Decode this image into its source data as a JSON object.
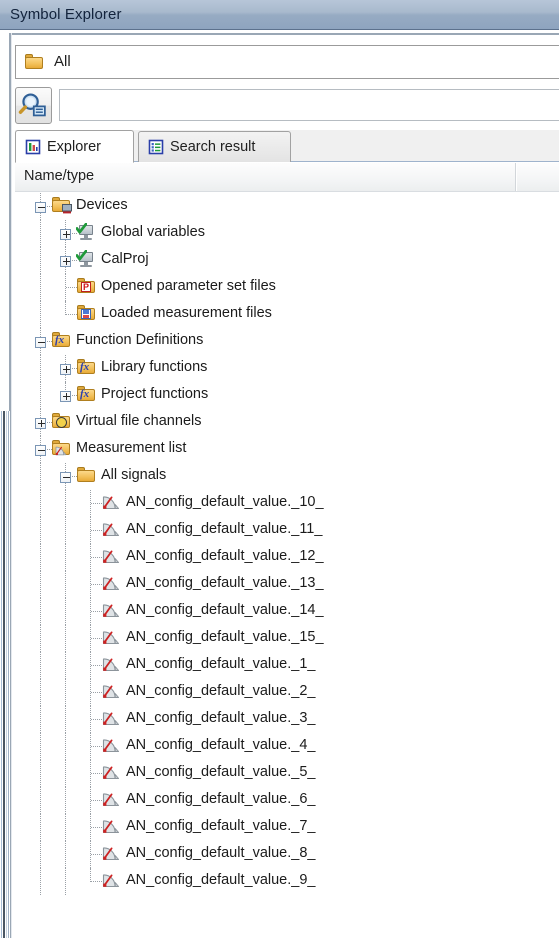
{
  "window": {
    "title": "Symbol Explorer"
  },
  "filter_bar": {
    "icon": "folder-icon",
    "label": "All"
  },
  "search": {
    "button_icon": "search-magnifier-icon",
    "value": "",
    "placeholder": ""
  },
  "tabs": [
    {
      "id": "explorer",
      "label": "Explorer",
      "icon": "explorer-tab-icon",
      "active": true
    },
    {
      "id": "search-result",
      "label": "Search result",
      "icon": "search-result-tab-icon",
      "active": false
    }
  ],
  "columns": [
    {
      "id": "name-type",
      "label": "Name/type"
    }
  ],
  "tree": [
    {
      "id": "devices",
      "label": "Devices",
      "icon": "devices-folder-icon",
      "depth": 0,
      "state": "expanded"
    },
    {
      "id": "global-variables",
      "label": "Global variables",
      "icon": "device-monitor-icon",
      "depth": 1,
      "state": "collapsed"
    },
    {
      "id": "calproj",
      "label": "CalProj",
      "icon": "device-monitor-icon",
      "depth": 1,
      "state": "collapsed"
    },
    {
      "id": "opened-param-sets",
      "label": "Opened parameter set files",
      "icon": "parameter-set-folder-icon",
      "depth": 1,
      "state": "leaf"
    },
    {
      "id": "loaded-measurement",
      "label": "Loaded measurement files",
      "icon": "measurement-file-folder-icon",
      "depth": 1,
      "state": "leaf"
    },
    {
      "id": "function-definitions",
      "label": "Function Definitions",
      "icon": "function-folder-icon",
      "depth": 0,
      "state": "expanded"
    },
    {
      "id": "library-functions",
      "label": "Library functions",
      "icon": "function-folder-icon",
      "depth": 1,
      "state": "collapsed"
    },
    {
      "id": "project-functions",
      "label": "Project functions",
      "icon": "function-folder-icon",
      "depth": 1,
      "state": "collapsed"
    },
    {
      "id": "virtual-file-channels",
      "label": "Virtual file channels",
      "icon": "virtual-file-channel-icon",
      "depth": 0,
      "state": "collapsed"
    },
    {
      "id": "measurement-list",
      "label": "Measurement list",
      "icon": "measurement-list-icon",
      "depth": 0,
      "state": "expanded"
    },
    {
      "id": "all-signals",
      "label": "All signals",
      "icon": "folder-icon",
      "depth": 1,
      "state": "expanded"
    },
    {
      "id": "sig-10",
      "label": "AN_config_default_value._10_",
      "icon": "signal-gauge-icon",
      "depth": 2,
      "state": "leaf"
    },
    {
      "id": "sig-11",
      "label": "AN_config_default_value._11_",
      "icon": "signal-gauge-icon",
      "depth": 2,
      "state": "leaf"
    },
    {
      "id": "sig-12",
      "label": "AN_config_default_value._12_",
      "icon": "signal-gauge-icon",
      "depth": 2,
      "state": "leaf"
    },
    {
      "id": "sig-13",
      "label": "AN_config_default_value._13_",
      "icon": "signal-gauge-icon",
      "depth": 2,
      "state": "leaf"
    },
    {
      "id": "sig-14",
      "label": "AN_config_default_value._14_",
      "icon": "signal-gauge-icon",
      "depth": 2,
      "state": "leaf"
    },
    {
      "id": "sig-15",
      "label": "AN_config_default_value._15_",
      "icon": "signal-gauge-icon",
      "depth": 2,
      "state": "leaf"
    },
    {
      "id": "sig-1",
      "label": "AN_config_default_value._1_",
      "icon": "signal-gauge-icon",
      "depth": 2,
      "state": "leaf"
    },
    {
      "id": "sig-2",
      "label": "AN_config_default_value._2_",
      "icon": "signal-gauge-icon",
      "depth": 2,
      "state": "leaf"
    },
    {
      "id": "sig-3",
      "label": "AN_config_default_value._3_",
      "icon": "signal-gauge-icon",
      "depth": 2,
      "state": "leaf"
    },
    {
      "id": "sig-4",
      "label": "AN_config_default_value._4_",
      "icon": "signal-gauge-icon",
      "depth": 2,
      "state": "leaf"
    },
    {
      "id": "sig-5",
      "label": "AN_config_default_value._5_",
      "icon": "signal-gauge-icon",
      "depth": 2,
      "state": "leaf"
    },
    {
      "id": "sig-6",
      "label": "AN_config_default_value._6_",
      "icon": "signal-gauge-icon",
      "depth": 2,
      "state": "leaf"
    },
    {
      "id": "sig-7",
      "label": "AN_config_default_value._7_",
      "icon": "signal-gauge-icon",
      "depth": 2,
      "state": "leaf"
    },
    {
      "id": "sig-8",
      "label": "AN_config_default_value._8_",
      "icon": "signal-gauge-icon",
      "depth": 2,
      "state": "leaf"
    },
    {
      "id": "sig-9",
      "label": "AN_config_default_value._9_",
      "icon": "signal-gauge-icon",
      "depth": 2,
      "state": "leaf"
    }
  ],
  "colors": {
    "titlebar_top": "#b7c6d8",
    "titlebar_bottom": "#8ea4bf",
    "tab_active_bg": "#ffffff",
    "tab_strip_bg": "#f0f0f0",
    "folder_icon": "#f3c25d",
    "signal_needle": "#cc2222",
    "tree_line": "#9aa0a6"
  }
}
